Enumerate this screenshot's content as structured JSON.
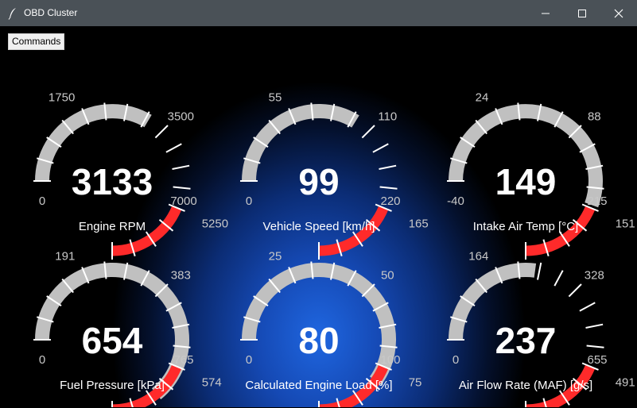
{
  "window": {
    "title": "OBD Cluster",
    "icon": "feather-icon",
    "controls": [
      "minimize-icon",
      "maximize-icon",
      "close-icon"
    ]
  },
  "menu": {
    "commands_label": "Commands"
  },
  "colors": {
    "arc_fill": "#c0c0c0",
    "redline": "#ff2a2a",
    "tick": "#ffffff",
    "label": "#c8c8c8",
    "value": "#ffffff"
  },
  "gauges": [
    {
      "title": "Engine RPM",
      "value": "3133",
      "min": 0,
      "max": 7000,
      "fraction": 0.4476,
      "labels": [
        "0",
        "1750",
        "3500",
        "5250",
        "7000"
      ]
    },
    {
      "title": "Vehicle Speed [km/h]",
      "value": "99",
      "min": 0,
      "max": 220,
      "fraction": 0.45,
      "labels": [
        "0",
        "55",
        "110",
        "165",
        "220"
      ]
    },
    {
      "title": "Intake Air Temp  [°C]",
      "value": "149",
      "min": -40,
      "max": 215,
      "fraction": 0.741,
      "labels": [
        "-40",
        "24",
        "88",
        "151",
        "215"
      ]
    },
    {
      "title": "Fuel Pressure [kPa]",
      "value": "654",
      "min": 0,
      "max": 765,
      "fraction": 0.855,
      "labels": [
        "0",
        "191",
        "383",
        "574",
        "765"
      ]
    },
    {
      "title": "Calculated Engine Load [%]",
      "value": "80",
      "min": 0,
      "max": 100,
      "fraction": 0.8,
      "labels": [
        "0",
        "25",
        "50",
        "75",
        "100"
      ]
    },
    {
      "title": "Air Flow Rate (MAF) [g/s]",
      "value": "237",
      "min": 0,
      "max": 655,
      "fraction": 0.362,
      "labels": [
        "0",
        "164",
        "328",
        "491",
        "655"
      ]
    }
  ]
}
